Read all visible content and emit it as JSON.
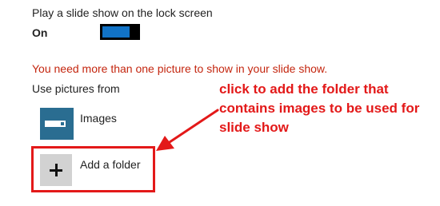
{
  "lock_screen": {
    "slideshow_title": "Play a slide show on the lock screen",
    "slideshow_state": "On",
    "slideshow_enabled": true,
    "accent_color": "#1173c7"
  },
  "warning": {
    "text": "You need more than one picture to show in your slide show.",
    "color": "#c4260f"
  },
  "sources": {
    "label": "Use pictures from",
    "folders": [
      {
        "name": "Images",
        "icon": "picture-folder-icon"
      }
    ],
    "add_button_label": "Add a folder",
    "add_icon": "plus-icon"
  },
  "annotation": {
    "text": "click to add the folder that contains images to be used for slide show",
    "color": "#e31919"
  }
}
